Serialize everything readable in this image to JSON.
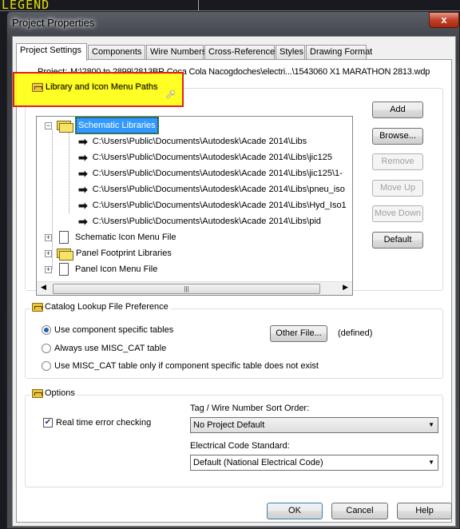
{
  "background": {
    "legend_text": "LEGEND"
  },
  "window": {
    "title": "Project Properties",
    "close_label": "x"
  },
  "tabs": [
    {
      "label": "Project Settings",
      "active": true
    },
    {
      "label": "Components"
    },
    {
      "label": "Wire Numbers"
    },
    {
      "label": "Cross-References"
    },
    {
      "label": "Styles"
    },
    {
      "label": "Drawing Format"
    }
  ],
  "project": {
    "label": "Project:",
    "path": "M:\\2800 to 2899\\2813BR Coca Cola Nacogdoches\\electri...\\1543060 X1 MARATHON 2813.wdp"
  },
  "library_group": {
    "title": "Library and Icon Menu Paths",
    "tree": {
      "root": {
        "label": "Schematic Libraries",
        "expanded": true,
        "selected": true
      },
      "paths": [
        "C:\\Users\\Public\\Documents\\Autodesk\\Acade 2014\\Libs",
        "C:\\Users\\Public\\Documents\\Autodesk\\Acade 2014\\Libs\\jic125",
        "C:\\Users\\Public\\Documents\\Autodesk\\Acade 2014\\Libs\\jic125\\1-",
        "C:\\Users\\Public\\Documents\\Autodesk\\Acade 2014\\Libs\\pneu_iso",
        "C:\\Users\\Public\\Documents\\Autodesk\\Acade 2014\\Libs\\Hyd_Iso1",
        "C:\\Users\\Public\\Documents\\Autodesk\\Acade 2014\\Libs\\pid"
      ],
      "others": [
        "Schematic Icon Menu File",
        "Panel Footprint Libraries",
        "Panel Icon Menu File"
      ]
    },
    "buttons": {
      "add": "Add",
      "browse": "Browse...",
      "remove": "Remove",
      "move_up": "Move Up",
      "move_down": "Move Down",
      "default": "Default"
    }
  },
  "catalog_group": {
    "title": "Catalog Lookup File Preference",
    "options": [
      "Use component specific tables",
      "Always use MISC_CAT table",
      "Use MISC_CAT table only if component specific table does not exist"
    ],
    "selected_index": 0,
    "other_file_button": "Other File...",
    "status": "(defined)"
  },
  "options_group": {
    "title": "Options",
    "realtime_check": {
      "label": "Real time error checking",
      "checked": true
    },
    "sort_order": {
      "label": "Tag / Wire Number Sort Order:",
      "value": "No Project Default"
    },
    "code_standard": {
      "label": "Electrical Code Standard:",
      "value": "Default (National Electrical Code)"
    }
  },
  "footer": {
    "ok": "OK",
    "cancel": "Cancel",
    "help": "Help"
  },
  "colors": {
    "highlight": "#ffff00",
    "highlight_border": "#e02020",
    "selection": "#3399ff"
  }
}
